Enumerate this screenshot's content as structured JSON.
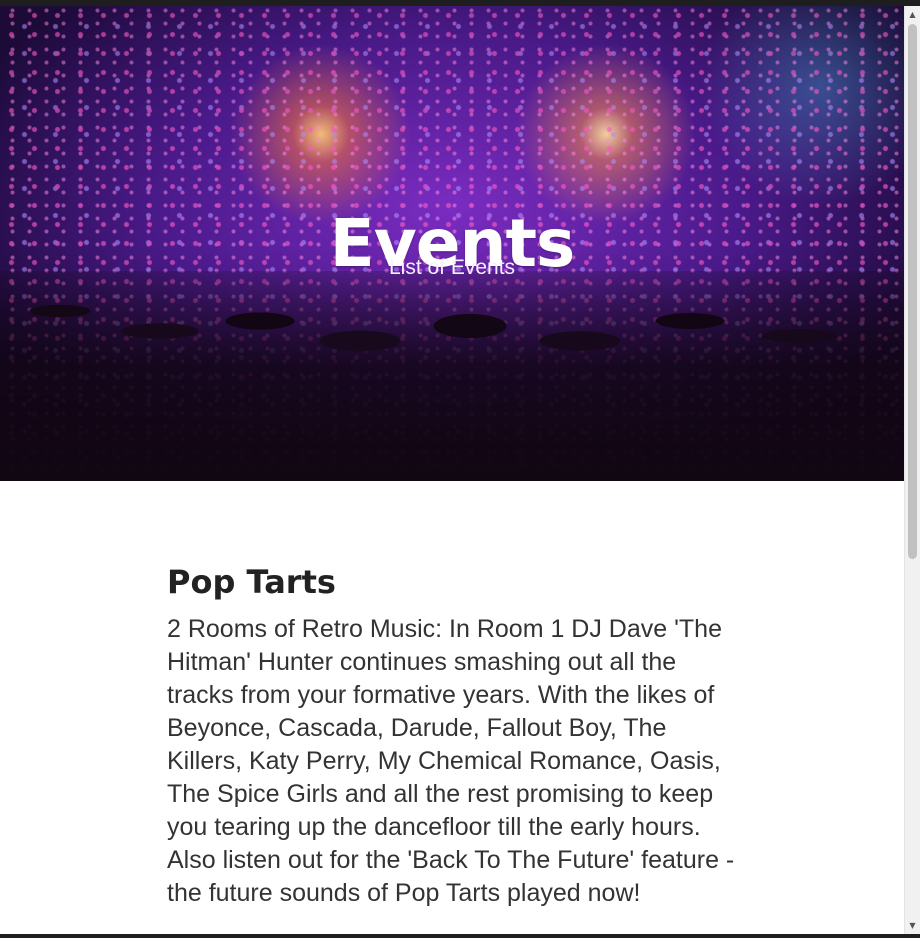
{
  "hero": {
    "title": "Events",
    "subtitle": "List of Events"
  },
  "events": [
    {
      "title": "Pop Tarts",
      "description": "2 Rooms of Retro Music: In Room 1 DJ Dave 'The Hitman' Hunter continues smashing out all the tracks from your formative years. With the likes of Beyonce, Cascada, Darude, Fallout Boy, The Killers, Katy Perry, My Chemical Romance, Oasis, The Spice Girls and all the rest promising to keep you tearing up the dancefloor till the early hours. Also listen out for the 'Back To The Future' feature - the future sounds of Pop Tarts played now!"
    }
  ],
  "scrollbar": {
    "up_icon": "triangle-up",
    "down_icon": "triangle-down"
  },
  "colors": {
    "hero_text": "#ffffff",
    "heading_text": "#222222",
    "body_text": "#333333",
    "scrollbar_track": "#f1f1f1",
    "scrollbar_thumb": "#c1c1c1"
  }
}
